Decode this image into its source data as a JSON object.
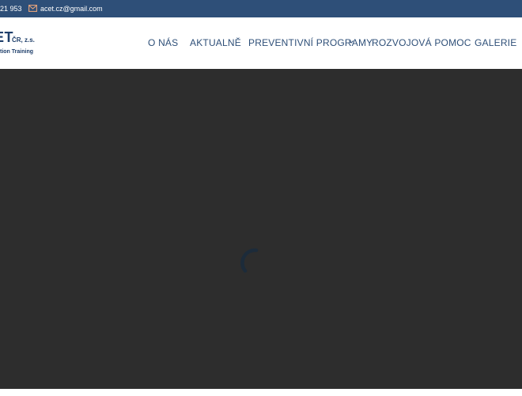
{
  "topbar": {
    "phone": "21 953",
    "email": "acet.cz@gmail.com",
    "icons": {
      "mail": "envelope-icon"
    },
    "colors": {
      "background": "#2e4f78",
      "icon": "#e8a57c"
    }
  },
  "logo": {
    "main": "ET",
    "suffix": "ČR, z.s.",
    "tagline": "tion Training",
    "color": "#1f3f6b"
  },
  "nav": {
    "items": [
      {
        "label": "O NÁS"
      },
      {
        "label": "AKTUALNĚ"
      },
      {
        "label": "PREVENTIVNÍ PROGRAMY",
        "has_dropdown": true
      },
      {
        "label": "ROZVOJOVÁ POMOC"
      },
      {
        "label": "GALERIE"
      }
    ],
    "color": "#2e4f78"
  },
  "loader": {
    "background": "#2d2d2d",
    "spinner_color": "#1c2b3a",
    "icon": "loading-spinner-icon"
  }
}
